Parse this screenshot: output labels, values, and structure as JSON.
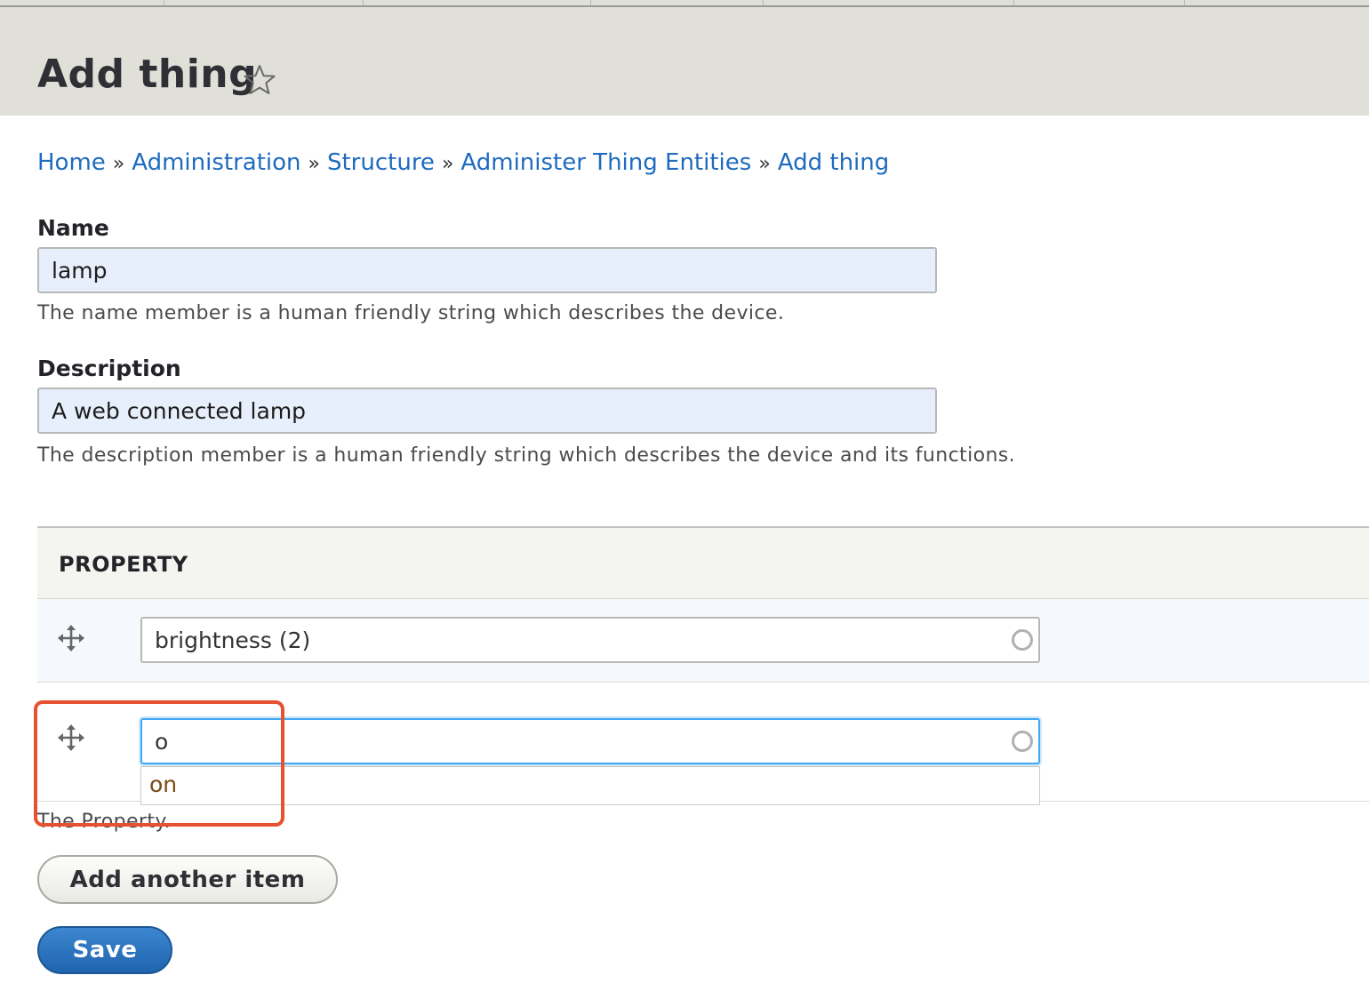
{
  "page": {
    "title": "Add thing"
  },
  "breadcrumb": {
    "items": [
      "Home",
      "Administration",
      "Structure",
      "Administer Thing Entities",
      "Add thing"
    ],
    "separator": "»"
  },
  "fields": {
    "name": {
      "label": "Name",
      "value": "lamp",
      "help": "The name member is a human friendly string which describes the device."
    },
    "description": {
      "label": "Description",
      "value": "A web connected lamp",
      "help": "The description member is a human friendly string which describes the device and its functions."
    }
  },
  "property": {
    "header": "PROPERTY",
    "rows": [
      {
        "value": "brightness (2)"
      },
      {
        "value": "o"
      }
    ],
    "autocomplete": [
      "on"
    ],
    "description": "The Property."
  },
  "buttons": {
    "add_another": "Add another item",
    "save": "Save"
  },
  "colors": {
    "link": "#1f6bbf",
    "header_bg": "#e0e0d8",
    "primary_button": "#2a70bb",
    "highlight": "#e6512f",
    "focus": "#40a8f5"
  },
  "icons": {
    "favorite": "star-outline-icon",
    "drag": "move-arrows-icon",
    "autocomplete": "throbber-icon"
  }
}
